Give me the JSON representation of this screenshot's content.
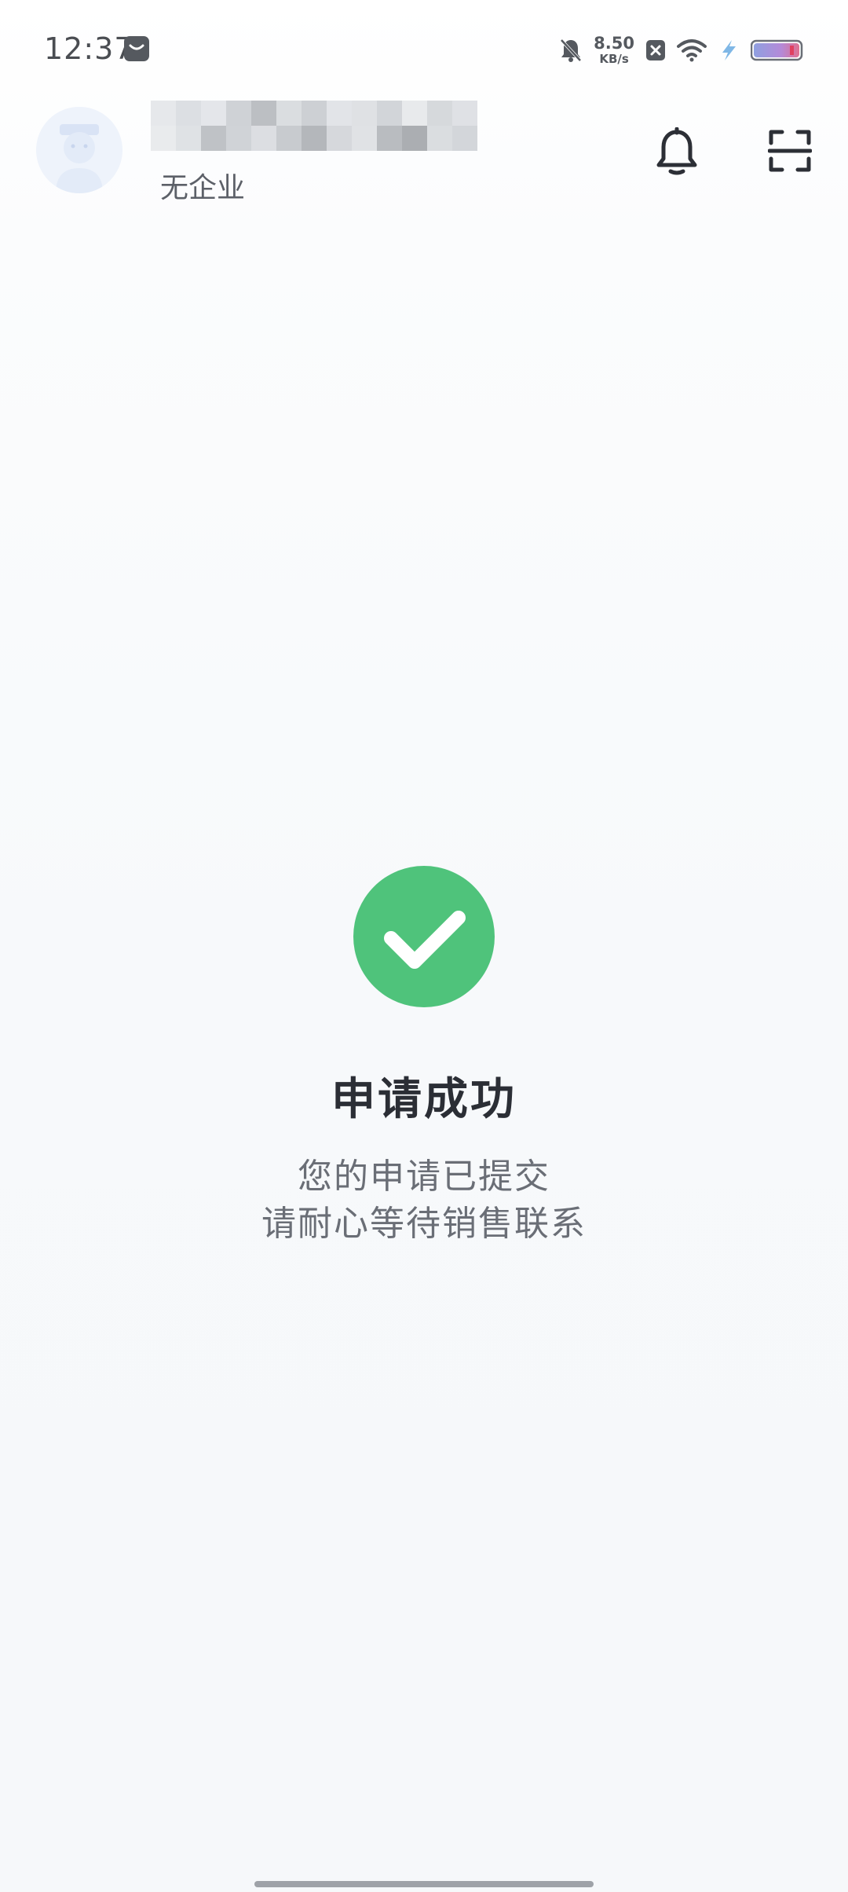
{
  "status_bar": {
    "time": "12:37",
    "net_speed_value": "8.50",
    "net_speed_unit": "KB/s",
    "icons": [
      "app-notification-icon",
      "bell-muted-icon",
      "close-box-icon",
      "wifi-icon",
      "charging-icon",
      "battery-icon"
    ]
  },
  "header": {
    "avatar_icon": "avatar-placeholder-icon",
    "company": "无企业",
    "bell_icon": "bell-icon",
    "scan_icon": "scan-icon"
  },
  "result": {
    "icon": "check-circle-icon",
    "icon_color": "#4fc37b",
    "title": "申请成功",
    "line1": "您的申请已提交",
    "line2": "请耐心等待销售联系"
  }
}
